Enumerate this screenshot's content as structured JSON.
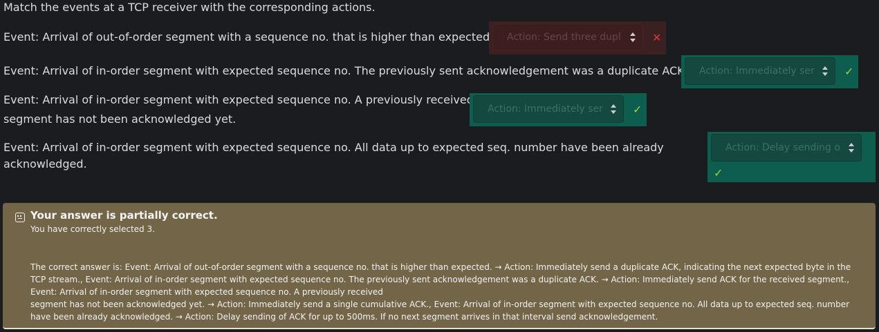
{
  "instruction": "Match the events at a TCP receiver with the corresponding actions.",
  "rows": [
    {
      "event_lines": [
        "Event: Arrival of out-of-order segment with a sequence no. that is higher than expected."
      ],
      "selected": "Action: Send three dupl",
      "status": "incorrect",
      "mark": "✕"
    },
    {
      "event_lines": [
        "Event: Arrival of in-order segment with expected sequence no. The previously sent acknowledgement was a duplicate ACK."
      ],
      "selected": "Action: Immediately ser",
      "status": "correct",
      "mark": "✓"
    },
    {
      "event_lines": [
        "Event: Arrival of in-order segment with expected sequence no. A previously received",
        "segment has not been acknowledged yet."
      ],
      "selected": "Action: Immediately ser",
      "status": "correct",
      "mark": "✓"
    },
    {
      "event_lines": [
        "Event: Arrival of in-order segment with expected sequence no. All data up to expected seq. number have been already",
        "acknowledged."
      ],
      "selected": "Action: Delay sending o",
      "status": "correct",
      "mark": "✓"
    }
  ],
  "feedback": {
    "icon": "partially-correct-face-icon",
    "title": "Your answer is partially correct.",
    "subtitle": "You have correctly selected 3.",
    "answer_lines": [
      "The correct answer is: Event: Arrival of out-of-order segment with a sequence no. that is higher than expected. → Action: Immediately send a duplicate ACK, indicating the next expected byte in the",
      "TCP stream., Event: Arrival of in-order segment with expected sequence no. The previously sent acknowledgement was a duplicate ACK. → Action: Immediately send ACK for the received segment.,",
      "Event: Arrival of in-order segment with expected sequence no. A previously received",
      "segment has not been acknowledged yet. → Action: Immediately send a single cumulative ACK., Event: Arrival of in-order segment with expected sequence no. All data up to expected seq. number",
      "have been already acknowledged. → Action: Delay sending of ACK for up to 500ms. If no next segment arrives in that interval send acknowledgement."
    ]
  },
  "colors": {
    "background": "#1b1c20",
    "correct_slot": "#0d5e4f",
    "incorrect_slot": "#3a2020",
    "feedback_bg": "#736547",
    "check": "#9ad23c",
    "cross": "#d93b3b"
  }
}
